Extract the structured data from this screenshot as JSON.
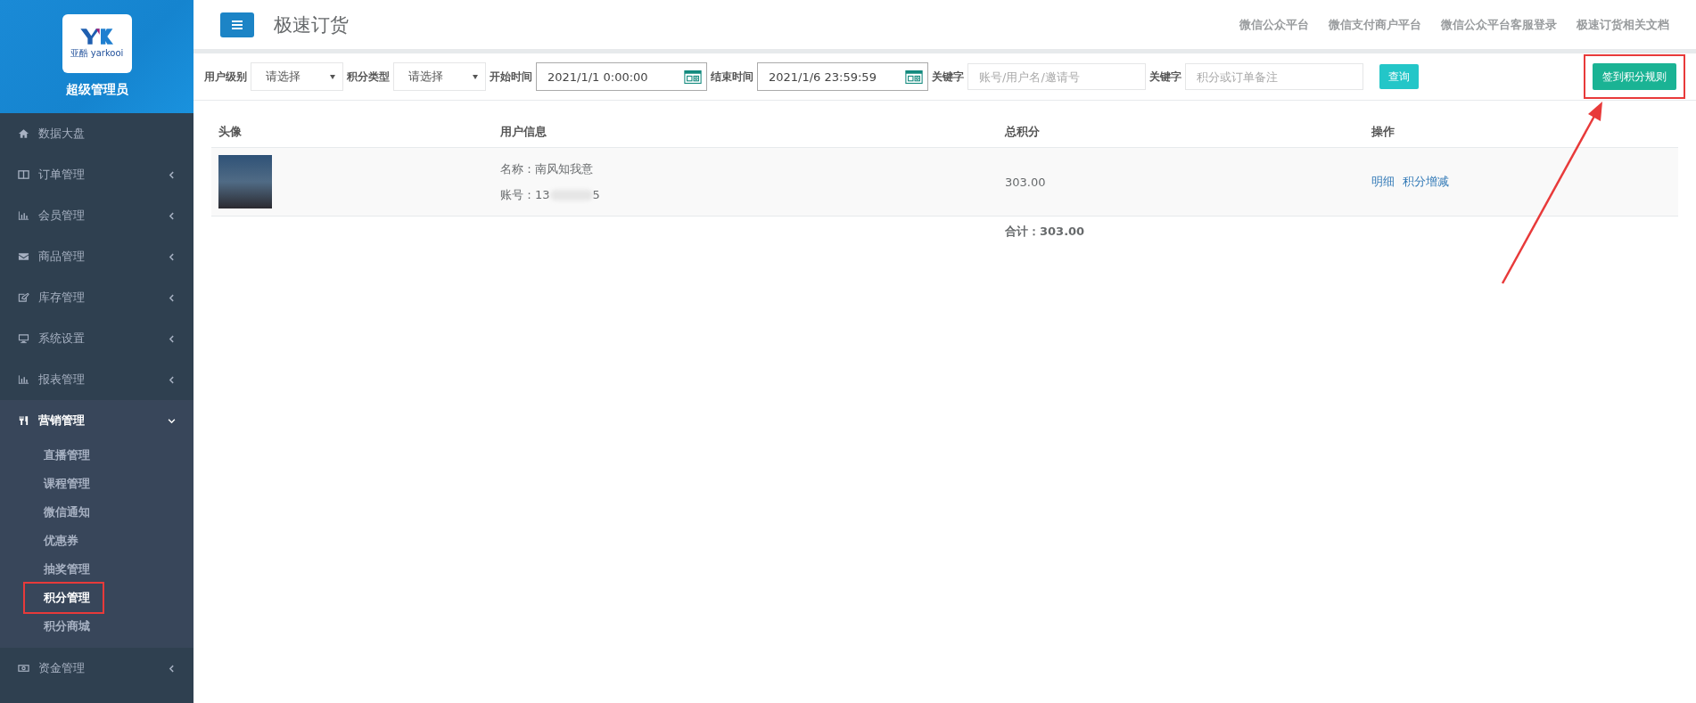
{
  "sidebar": {
    "logo_text": "亚酷 yarkooi",
    "user_name": "超级管理员",
    "items": [
      {
        "label": "数据大盘",
        "kind": "home",
        "has_caret": false,
        "expanded": false
      },
      {
        "label": "订单管理",
        "kind": "columns",
        "has_caret": true,
        "expanded": false
      },
      {
        "label": "会员管理",
        "kind": "chart",
        "has_caret": true,
        "expanded": false
      },
      {
        "label": "商品管理",
        "kind": "envelope",
        "has_caret": true,
        "expanded": false
      },
      {
        "label": "库存管理",
        "kind": "edit",
        "has_caret": true,
        "expanded": false
      },
      {
        "label": "系统设置",
        "kind": "monitor",
        "has_caret": true,
        "expanded": false
      },
      {
        "label": "报表管理",
        "kind": "chart",
        "has_caret": true,
        "expanded": false
      },
      {
        "label": "营销管理",
        "kind": "cutlery",
        "has_caret": true,
        "expanded": true,
        "children": [
          {
            "label": "直播管理",
            "selected": false,
            "highlighted": false
          },
          {
            "label": "课程管理",
            "selected": false,
            "highlighted": false
          },
          {
            "label": "微信通知",
            "selected": false,
            "highlighted": false
          },
          {
            "label": "优惠券",
            "selected": false,
            "highlighted": false
          },
          {
            "label": "抽奖管理",
            "selected": false,
            "highlighted": false
          },
          {
            "label": "积分管理",
            "selected": true,
            "highlighted": true
          },
          {
            "label": "积分商城",
            "selected": false,
            "highlighted": false
          }
        ]
      },
      {
        "label": "资金管理",
        "kind": "money",
        "has_caret": true,
        "expanded": false
      }
    ]
  },
  "header": {
    "title": "极速订货",
    "links": [
      "微信公众平台",
      "微信支付商户平台",
      "微信公众平台客服登录",
      "极速订货相关文档"
    ]
  },
  "filters": [
    {
      "kind": "select",
      "label": "用户级别",
      "value": "请选择"
    },
    {
      "kind": "select",
      "label": "积分类型",
      "value": "请选择"
    },
    {
      "kind": "date",
      "label": "开始时间",
      "value": "2021/1/1 0:00:00"
    },
    {
      "kind": "date",
      "label": "结束时间",
      "value": "2021/1/6 23:59:59"
    },
    {
      "kind": "text",
      "label": "关键字",
      "placeholder": "账号/用户名/邀请号"
    },
    {
      "kind": "text",
      "label": "关键字",
      "placeholder": "积分或订单备注"
    }
  ],
  "search_button": "查询",
  "rule_button": {
    "label": "签到积分规则",
    "highlighted": true
  },
  "table": {
    "columns": [
      "头像",
      "用户信息",
      "总积分",
      "操作"
    ],
    "rows": [
      {
        "name_label": "名称：",
        "name": "南风知我意",
        "account_label": "账号：",
        "account_prefix": "13",
        "account_suffix": "5",
        "total": "303.00",
        "actions": [
          "明细",
          "积分增减"
        ]
      }
    ],
    "sum_label": "合计：",
    "sum": "303.00"
  }
}
